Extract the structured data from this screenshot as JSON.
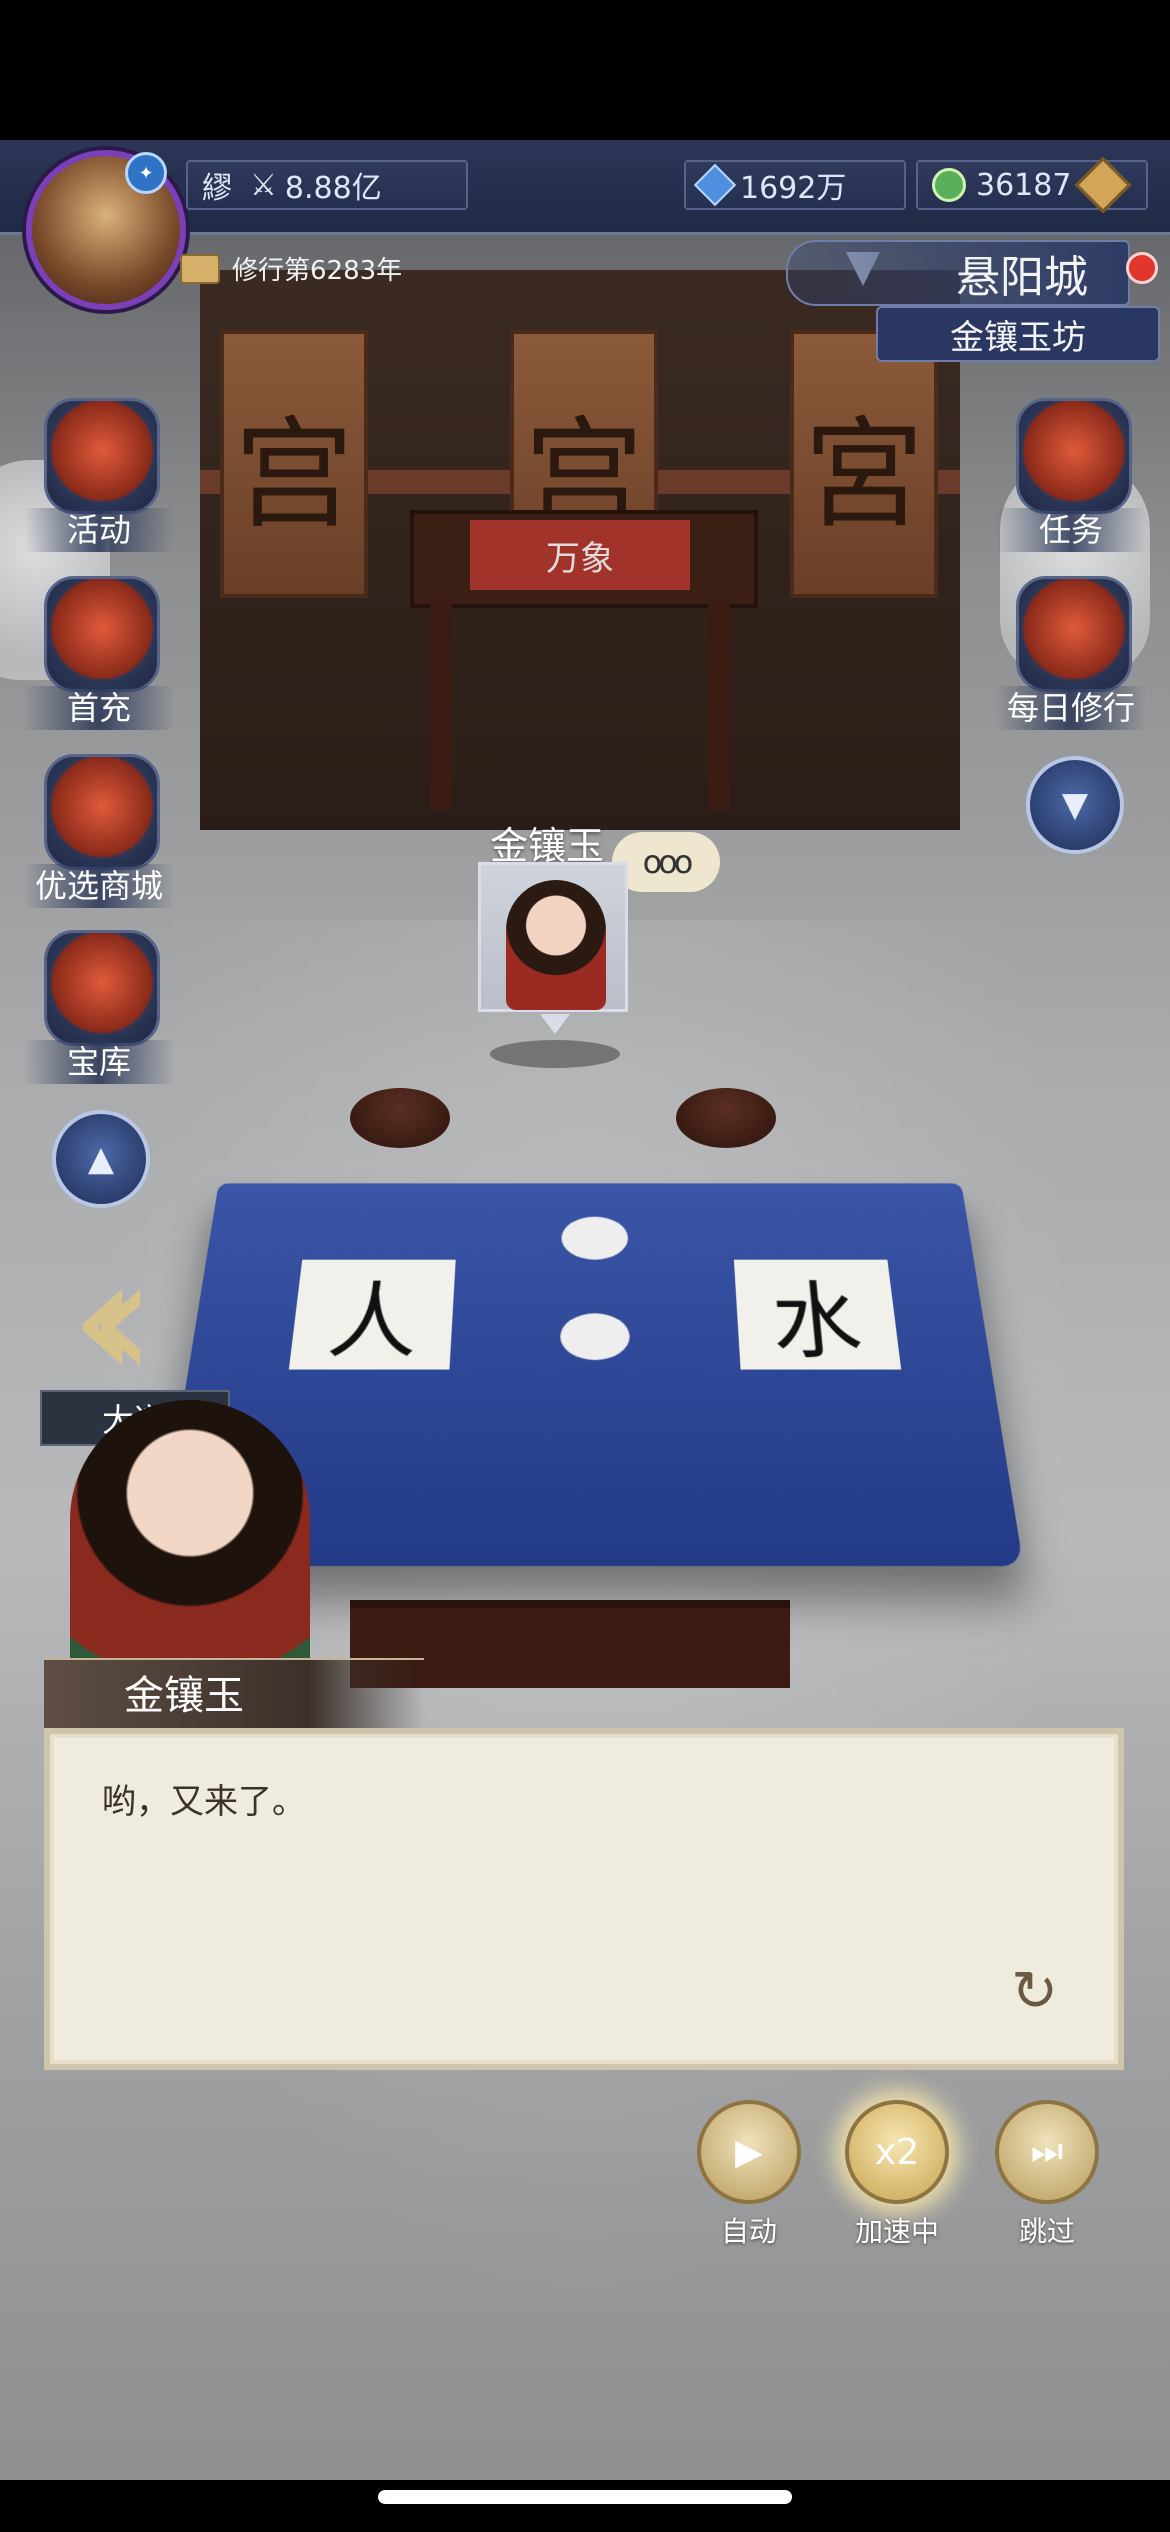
{
  "hud": {
    "player_name": "繆",
    "power_value": "8.88亿",
    "spirit_stones": "1692万",
    "jade_coins": "36187",
    "cultivation_years": "修行第6283年"
  },
  "location": {
    "city": "悬阳城",
    "place": "金镶玉坊"
  },
  "left_menu": [
    {
      "label": "活动",
      "icon": "lantern-icon"
    },
    {
      "label": "首充",
      "icon": "money-bag-icon"
    },
    {
      "label": "优选商城",
      "icon": "gift-box-icon"
    },
    {
      "label": "宝库",
      "icon": "treasure-box-icon"
    }
  ],
  "right_menu": [
    {
      "label": "任务",
      "icon": "scroll-icon"
    },
    {
      "label": "每日修行",
      "icon": "book-icon"
    }
  ],
  "dadao_label": "大道",
  "scene": {
    "plaque_chars": [
      "宫",
      "宫",
      "宮"
    ],
    "altar_text": "万象",
    "paper_left": "人",
    "paper_right": "水"
  },
  "npc": {
    "name": "金镶玉",
    "speech_bubble": "ooo"
  },
  "dialog": {
    "speaker": "金镶玉",
    "text": "哟，又来了。"
  },
  "controls": [
    {
      "label": "自动",
      "glyph": "▶",
      "icon": "play-icon"
    },
    {
      "label": "加速中",
      "glyph": "x2",
      "icon": "speed-x2-icon"
    },
    {
      "label": "跳过",
      "glyph": "⏭",
      "icon": "skip-icon"
    }
  ],
  "colors": {
    "hud_bg": "#1f2a46",
    "dialog_bg": "#f0ecdd",
    "table_blue": "#2b44a0",
    "gold_accent": "#d2a656"
  }
}
